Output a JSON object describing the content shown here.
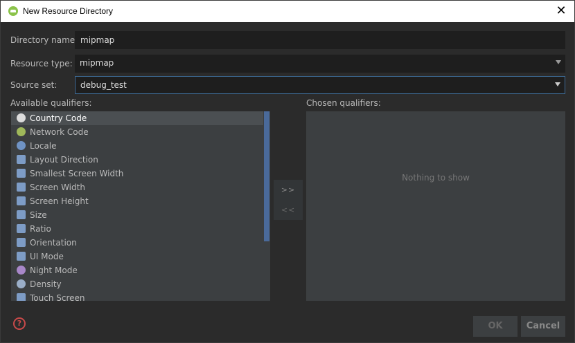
{
  "window": {
    "title": "New Resource Directory",
    "close_glyph": "✕"
  },
  "form": {
    "directory_name_label": "Directory name:",
    "directory_name_value": "mipmap",
    "resource_type_label": "Resource type:",
    "resource_type_value": "mipmap",
    "source_set_label": "Source set:",
    "source_set_value": "debug_test"
  },
  "available": {
    "label": "Available qualifiers:",
    "items": [
      {
        "label": "Country Code",
        "icon": "globe-flag-icon"
      },
      {
        "label": "Network Code",
        "icon": "network-icon"
      },
      {
        "label": "Locale",
        "icon": "globe-icon"
      },
      {
        "label": "Layout Direction",
        "icon": "layout-direction-icon"
      },
      {
        "label": "Smallest Screen Width",
        "icon": "smallest-width-icon"
      },
      {
        "label": "Screen Width",
        "icon": "screen-width-icon"
      },
      {
        "label": "Screen Height",
        "icon": "screen-height-icon"
      },
      {
        "label": "Size",
        "icon": "size-icon"
      },
      {
        "label": "Ratio",
        "icon": "ratio-icon"
      },
      {
        "label": "Orientation",
        "icon": "orientation-icon"
      },
      {
        "label": "UI Mode",
        "icon": "ui-mode-icon"
      },
      {
        "label": "Night Mode",
        "icon": "night-mode-icon"
      },
      {
        "label": "Density",
        "icon": "density-icon"
      },
      {
        "label": "Touch Screen",
        "icon": "touch-screen-icon"
      }
    ]
  },
  "transfer": {
    "add_label": ">>",
    "remove_label": "<<"
  },
  "chosen": {
    "label": "Chosen qualifiers:",
    "empty_text": "Nothing to show"
  },
  "footer": {
    "help_glyph": "?",
    "ok_label": "OK",
    "cancel_label": "Cancel"
  }
}
